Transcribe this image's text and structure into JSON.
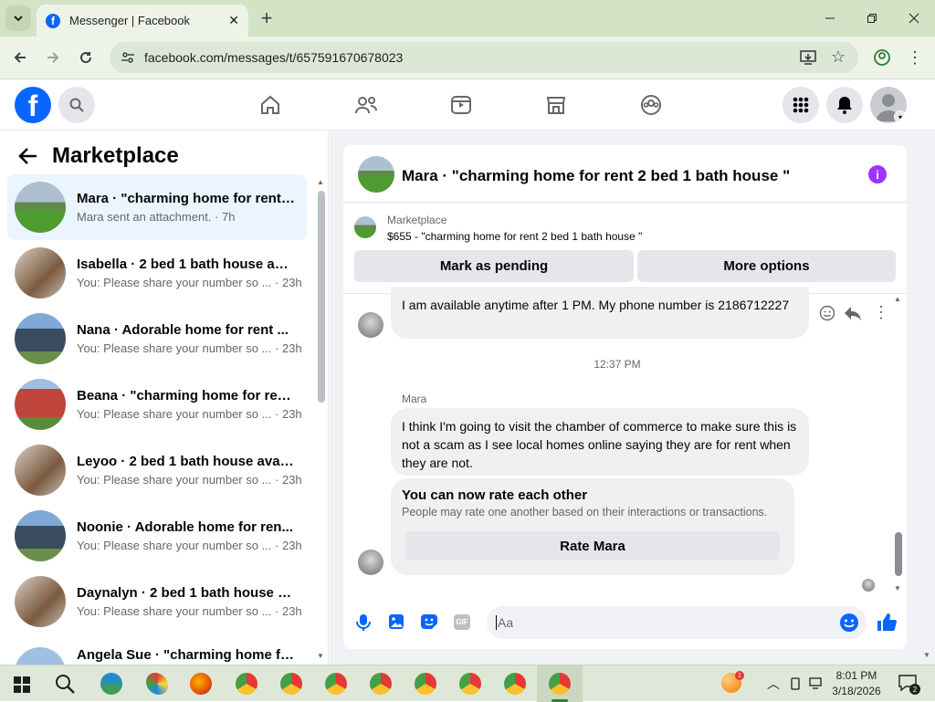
{
  "browser": {
    "tab_title": "Messenger | Facebook",
    "url": "facebook.com/messages/t/657591670678023"
  },
  "sidebar": {
    "title": "Marketplace",
    "conversations": [
      {
        "title": "Mara · \"charming home for rent ...",
        "subtitle": "Mara sent an attachment. · 7h",
        "active": true
      },
      {
        "title": "Isabella · 2 bed 1 bath house ava...",
        "subtitle": "You: Please share your number so ... · 23h"
      },
      {
        "title": "Nana · Adorable home for rent ...",
        "subtitle": "You: Please share your number so ... · 23h"
      },
      {
        "title": "Beana · \"charming home for ren...",
        "subtitle": "You: Please share your number so ... · 23h"
      },
      {
        "title": "Leyoo · 2 bed 1 bath house avail...",
        "subtitle": "You: Please share your number so ... · 23h"
      },
      {
        "title": "Noonie · Adorable home for ren...",
        "subtitle": "You: Please share your number so ... · 23h"
      },
      {
        "title": "Daynalyn · 2 bed 1 bath house a...",
        "subtitle": "You: Please share your number so ... · 23h"
      },
      {
        "title": "Angela Sue · \"charming home fo...",
        "subtitle": ""
      }
    ]
  },
  "chat": {
    "header_title": "Mara · \"charming home for rent 2 bed 1 bath house \"",
    "listing_label": "Marketplace",
    "listing_text": "$655 - \"charming home for rent 2 bed 1 bath house \"",
    "mark_pending": "Mark as pending",
    "more_options": "More options",
    "msg1": "I am available anytime after 1 PM. My phone number is 2186712227",
    "timestamp": "12:37 PM",
    "sender_name": "Mara",
    "msg2": "I think I'm going to visit the chamber of commerce to make sure this is not a scam as I see local homes online saying they are for rent when they are not.",
    "rate_title": "You can now rate each other",
    "rate_desc": "People may rate one another based on their interactions or transactions.",
    "rate_button": "Rate Mara",
    "input_placeholder": "Aa"
  },
  "taskbar": {
    "time": "8:01 PM",
    "date": "3/18/2026",
    "notification_count": "2",
    "badge": "1"
  },
  "colors": {
    "fb_blue": "#0866ff",
    "purple": "#a033ff",
    "taskbar": "#dfe8d8"
  }
}
